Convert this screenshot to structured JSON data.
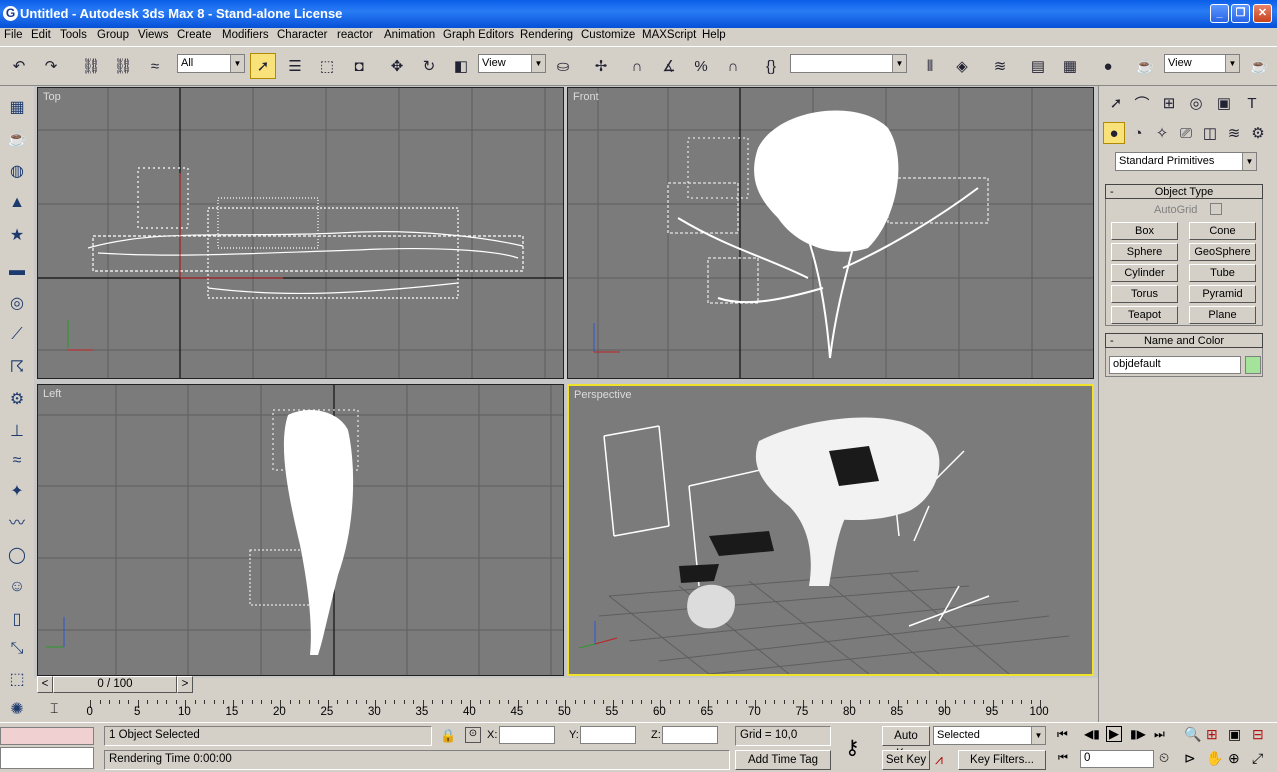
{
  "titlebar": {
    "title": "Untitled - Autodesk 3ds Max 8 - Stand-alone License",
    "icon": "3dsmax-icon"
  },
  "menu": [
    "File",
    "Edit",
    "Tools",
    "Group",
    "Views",
    "Create",
    "Modifiers",
    "Character",
    "reactor",
    "Animation",
    "Graph Editors",
    "Rendering",
    "Customize",
    "MAXScript",
    "Help"
  ],
  "toolbar": {
    "selection_filter": "All",
    "reference_coord": "View",
    "named_selection": "",
    "render_view": "View"
  },
  "viewports": {
    "top": "Top",
    "front": "Front",
    "left": "Left",
    "perspective": "Perspective"
  },
  "command_panel": {
    "category_dropdown": "Standard Primitives",
    "object_type_title": "Object Type",
    "autogrid_label": "AutoGrid",
    "buttons": [
      "Box",
      "Cone",
      "Sphere",
      "GeoSphere",
      "Cylinder",
      "Tube",
      "Torus",
      "Pyramid",
      "Teapot",
      "Plane"
    ],
    "name_color_title": "Name and Color",
    "object_name": "objdefault",
    "object_color": "#a4e39a"
  },
  "time_slider": {
    "label": "0 / 100",
    "prev": "<",
    "next": ">"
  },
  "trackbar": {
    "ticks": [
      "0",
      "5",
      "10",
      "15",
      "20",
      "25",
      "30",
      "35",
      "40",
      "45",
      "50",
      "55",
      "60",
      "65",
      "70",
      "75",
      "80",
      "85",
      "90",
      "95",
      "100"
    ]
  },
  "status": {
    "selection_info": "1 Object Selected",
    "render_time": "Rendering Time  0:00:00",
    "x_label": "X:",
    "y_label": "Y:",
    "z_label": "Z:",
    "grid": "Grid = 10,0",
    "add_time_tag": "Add Time Tag",
    "auto_key": "Auto Key",
    "set_key": "Set Key",
    "key_mode": "Selected",
    "key_filters": "Key Filters...",
    "frame": "0"
  }
}
